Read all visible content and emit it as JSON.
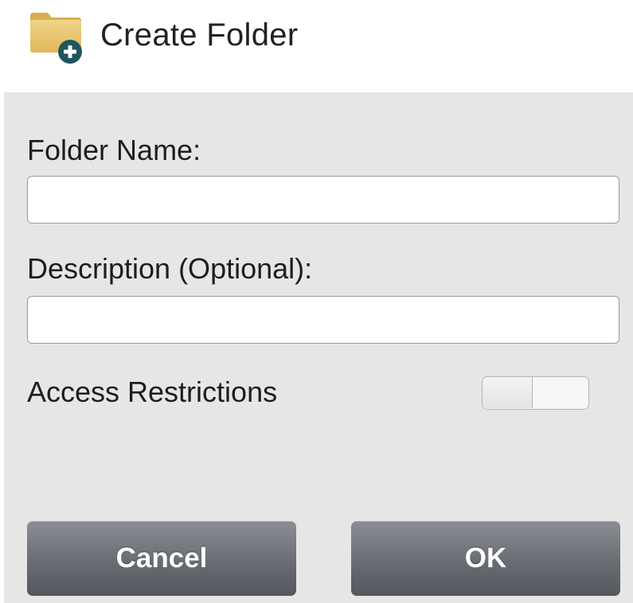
{
  "dialog": {
    "title": "Create Folder",
    "icon": "folder-add-icon"
  },
  "form": {
    "folder_name": {
      "label": "Folder Name:",
      "value": "",
      "placeholder": ""
    },
    "description": {
      "label": "Description (Optional):",
      "value": "",
      "placeholder": ""
    },
    "access_restrictions": {
      "label": "Access Restrictions",
      "enabled": false
    }
  },
  "buttons": {
    "cancel_label": "Cancel",
    "ok_label": "OK"
  },
  "colors": {
    "panel_background": "#e6e6e6",
    "button_gradient_top": "#8c8e96",
    "button_gradient_bottom": "#55575e",
    "folder_yellow": "#e9c46a",
    "plus_badge": "#1f5660"
  }
}
